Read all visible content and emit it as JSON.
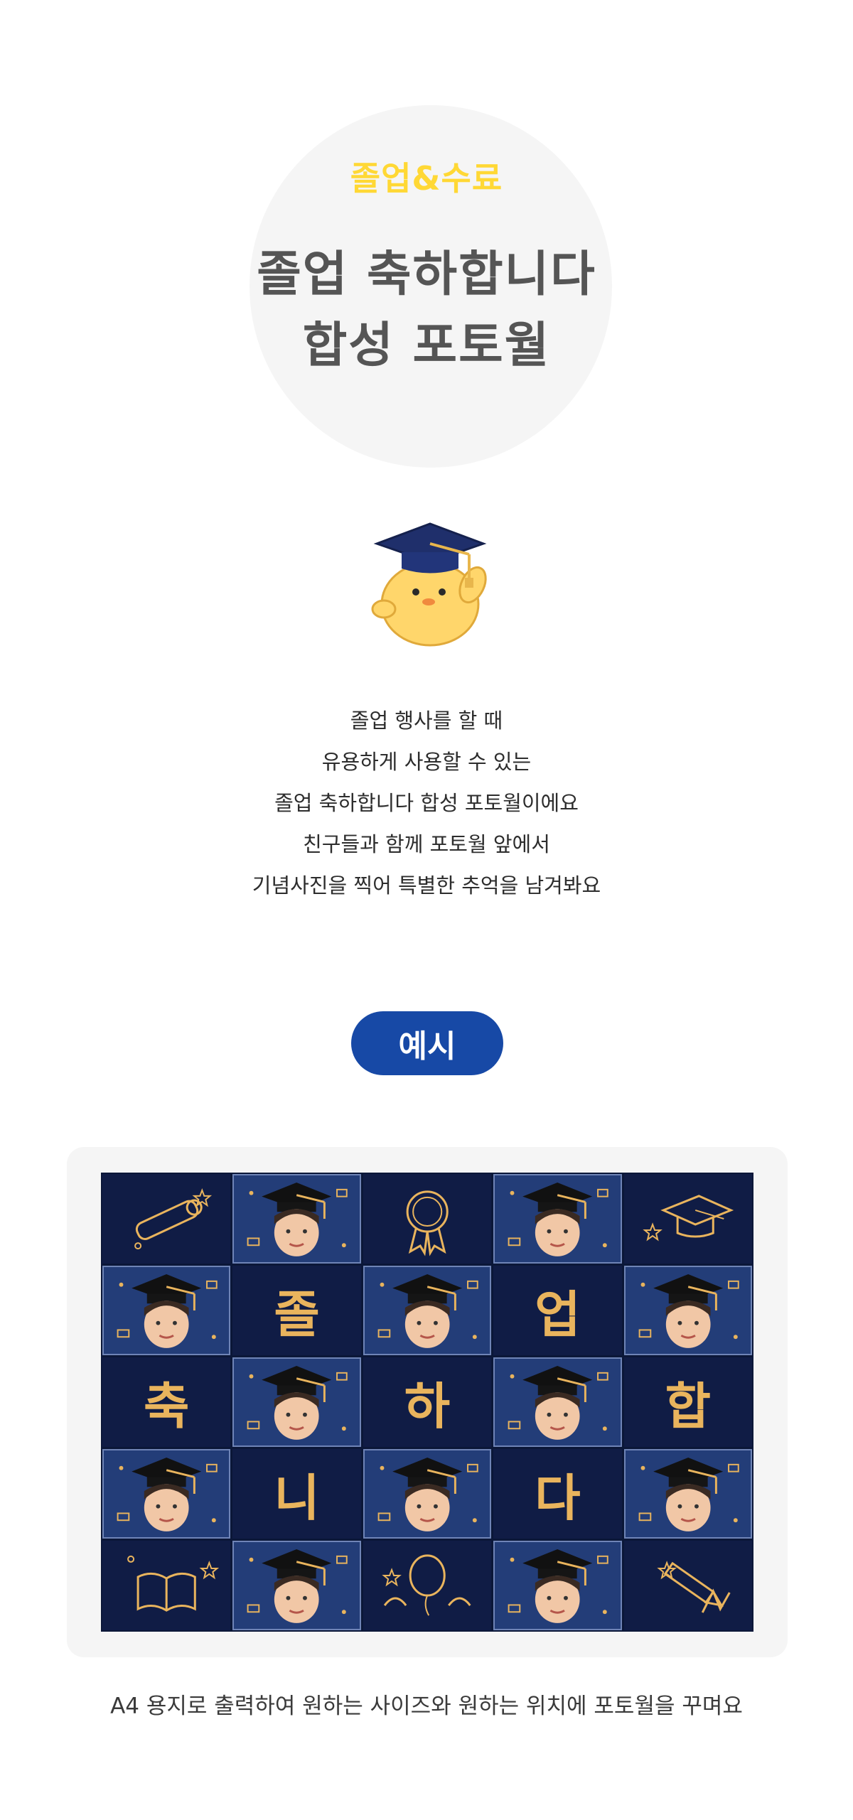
{
  "hero": {
    "tag": "졸업&수료",
    "title_line1": "졸업 축하합니다",
    "title_line2": "합성 포토월"
  },
  "mascot": {
    "icon": "chick-graduation-cap-icon"
  },
  "description": [
    "졸업 행사를 할 때",
    "유용하게 사용할 수 있는",
    "졸업 축하합니다 합성 포토월이에요",
    "친구들과 함께 포토월 앞에서",
    "기념사진을 찍어 특별한 추억을 남겨봐요"
  ],
  "example_label": "예시",
  "board": {
    "cells": [
      {
        "kind": "icon",
        "icon": "diploma-scroll-icon"
      },
      {
        "kind": "photo",
        "icon": "graduate-face-icon"
      },
      {
        "kind": "icon",
        "icon": "medal-ribbon-icon"
      },
      {
        "kind": "photo",
        "icon": "graduate-face-icon"
      },
      {
        "kind": "icon",
        "icon": "graduation-cap-icon"
      },
      {
        "kind": "photo",
        "icon": "graduate-face-icon"
      },
      {
        "kind": "text",
        "text": "졸"
      },
      {
        "kind": "photo",
        "icon": "graduate-face-icon"
      },
      {
        "kind": "text",
        "text": "업"
      },
      {
        "kind": "photo",
        "icon": "graduate-face-icon"
      },
      {
        "kind": "text",
        "text": "축"
      },
      {
        "kind": "photo",
        "icon": "graduate-face-icon"
      },
      {
        "kind": "text",
        "text": "하"
      },
      {
        "kind": "photo",
        "icon": "graduate-face-icon"
      },
      {
        "kind": "text",
        "text": "합"
      },
      {
        "kind": "photo",
        "icon": "graduate-face-icon"
      },
      {
        "kind": "text",
        "text": "니"
      },
      {
        "kind": "photo",
        "icon": "graduate-face-icon"
      },
      {
        "kind": "text",
        "text": "다"
      },
      {
        "kind": "photo",
        "icon": "graduate-face-icon"
      },
      {
        "kind": "icon",
        "icon": "open-book-icon"
      },
      {
        "kind": "photo",
        "icon": "graduate-face-icon"
      },
      {
        "kind": "icon",
        "icon": "balloon-icon"
      },
      {
        "kind": "photo",
        "icon": "graduate-face-icon"
      },
      {
        "kind": "icon",
        "icon": "pencil-icon"
      }
    ]
  },
  "caption": "A4 용지로 출력하여 원하는 사이즈와 원하는 위치에 포토월을 꾸며요",
  "colors": {
    "tag": "#ffd835",
    "title": "#555555",
    "pill": "#1749a6",
    "board_bg": "#101c45",
    "photo_bg": "#233d78",
    "gold": "#e9b45d"
  }
}
